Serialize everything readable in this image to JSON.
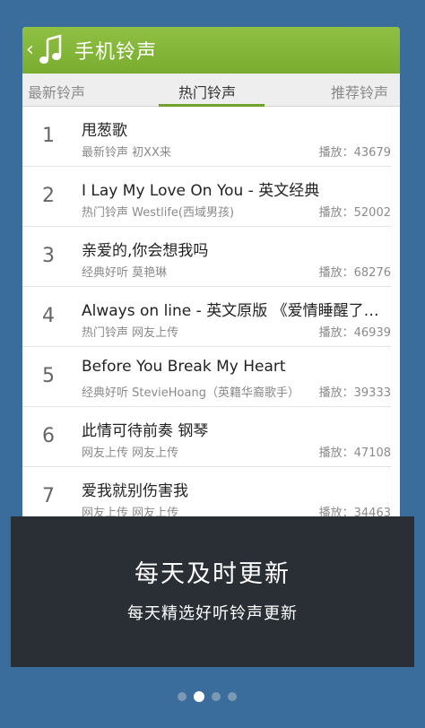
{
  "header": {
    "back_icon": "chevron-left-icon",
    "app_icon": "music-note-icon",
    "title": "手机铃声"
  },
  "tabs": [
    {
      "label": "最新铃声",
      "active": false
    },
    {
      "label": "热门铃声",
      "active": true
    },
    {
      "label": "推荐铃声",
      "active": false
    }
  ],
  "songs": [
    {
      "num": "1",
      "title": "甩葱歌",
      "meta": "最新铃声 初XX来",
      "plays": "播放：43679"
    },
    {
      "num": "2",
      "title": "I Lay My Love On You - 英文经典",
      "meta": "热门铃声 Westlife(西域男孩)",
      "plays": "播放：52002"
    },
    {
      "num": "3",
      "title": "亲爱的,你会想我吗",
      "meta": "经典好听 莫艳琳",
      "plays": "播放：68276"
    },
    {
      "num": "4",
      "title": "Always on line - 英文原版 《爱情睡醒了…",
      "meta": "热门铃声 网友上传",
      "plays": "播放：46939"
    },
    {
      "num": "5",
      "title": "Before You Break My Heart",
      "meta": "经典好听 StevieHoang（英籍华裔歌手）",
      "plays": "播放：39333"
    },
    {
      "num": "6",
      "title": "此情可待前奏 钢琴",
      "meta": "网友上传 网友上传",
      "plays": "播放：47108"
    },
    {
      "num": "7",
      "title": "爱我就别伤害我",
      "meta": "网友上传 网友上传",
      "plays": "播放：34463"
    }
  ],
  "overlay": {
    "title": "每天及时更新",
    "subtitle": "每天精选好听铃声更新"
  },
  "pager": {
    "count": 4,
    "active_index": 1
  },
  "colors": {
    "background": "#3a6d9c",
    "titlebar": "#83b637",
    "overlay": "#2a2f36"
  }
}
